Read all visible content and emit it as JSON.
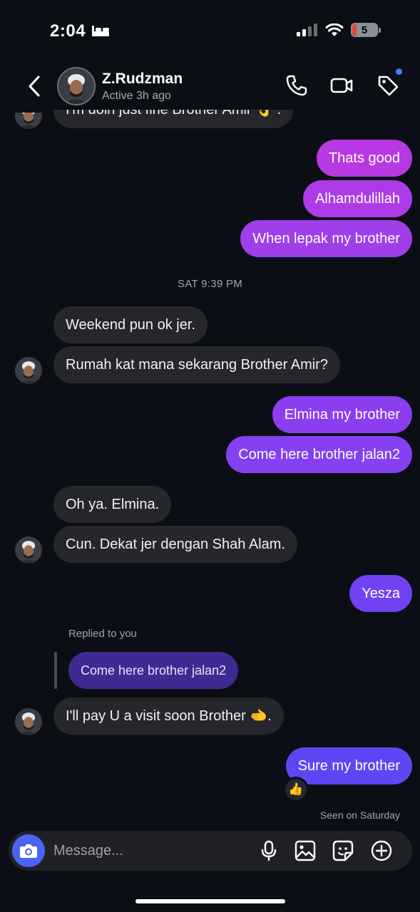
{
  "status_bar": {
    "time": "2:04",
    "battery": "5"
  },
  "header": {
    "contact_name": "Z.Rudzman",
    "contact_status": "Active 3h ago"
  },
  "messages": {
    "partial_incoming": "I'm doin just fine Brother Amir 👌 .",
    "out1": "Thats good",
    "out2": "Alhamdulillah",
    "out3": "When lepak my brother",
    "timestamp": "SAT 9:39 PM",
    "in1": "Weekend pun ok jer.",
    "in2": "Rumah kat mana sekarang Brother Amir?",
    "out4": "Elmina my brother",
    "out5": "Come here brother jalan2",
    "in3": "Oh ya. Elmina.",
    "in4": "Cun. Dekat jer dengan Shah Alam.",
    "out6": "Yesza",
    "reply_label": "Replied to you",
    "reply_quote": "Come here brother jalan2",
    "in5": "I'll pay U a visit soon Brother 🫲.",
    "out7": "Sure my brother",
    "reaction": "👍",
    "seen": "Seen on Saturday"
  },
  "composer": {
    "placeholder": "Message..."
  },
  "icons": {
    "back": "chevron-left-icon",
    "phone": "phone-icon",
    "video": "video-camera-icon",
    "tag": "tag-icon",
    "camera": "camera-icon",
    "mic": "microphone-icon",
    "gallery": "image-icon",
    "sticker": "sticker-icon",
    "plus": "plus-circle-icon"
  },
  "colors": {
    "background": "#0c0e15",
    "incoming": "#25272d",
    "outgoing_start": "#b536e4",
    "outgoing_end": "#7b3ff2",
    "camera_button": "#4c63f5"
  }
}
